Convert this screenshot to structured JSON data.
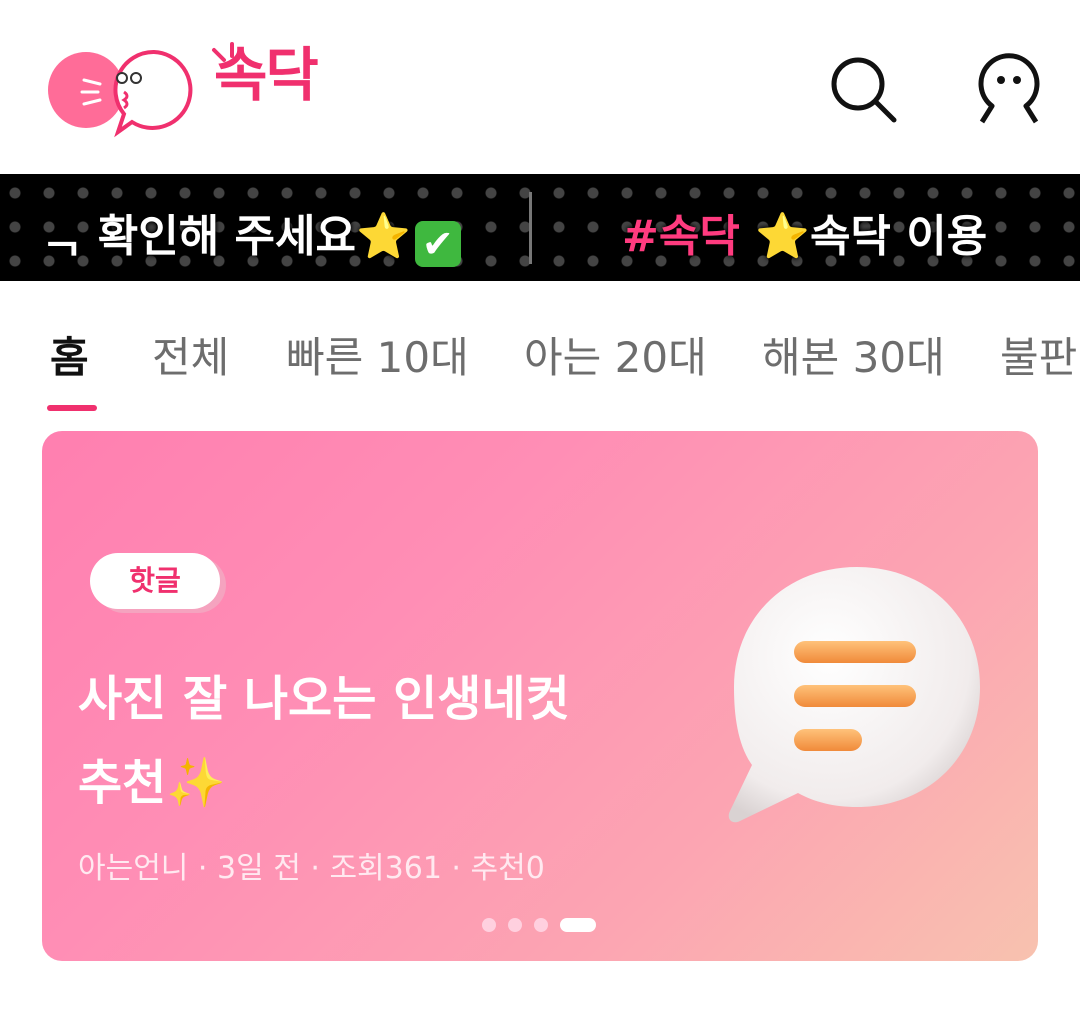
{
  "app": {
    "logo_text": "속닥",
    "brand_color": "#f0306e"
  },
  "header": {
    "search_icon": "search-icon",
    "profile_icon": "profile-icon"
  },
  "ticker": {
    "left_text": "ᆨ 확인해 주세요",
    "left_star": "⭐",
    "left_check": "✔",
    "right_hashtag": "#속닥",
    "right_star": "⭐",
    "right_text": "속닥 이용"
  },
  "tabs": [
    {
      "label": "홈",
      "active": true
    },
    {
      "label": "전체"
    },
    {
      "label": "빠른 10대"
    },
    {
      "label": "아는 20대"
    },
    {
      "label": "해본 30대"
    },
    {
      "label": "불판"
    }
  ],
  "banner": {
    "badge": "핫글",
    "title_line1": "사진 잘 나오는 인생네컷",
    "title_line2": "추천",
    "sparkle": "✨",
    "meta": "아는언니 · 3일 전 · 조회361 · 추천0",
    "icon": "chat-bubble-icon",
    "pager_total": 4,
    "pager_active": 4
  }
}
